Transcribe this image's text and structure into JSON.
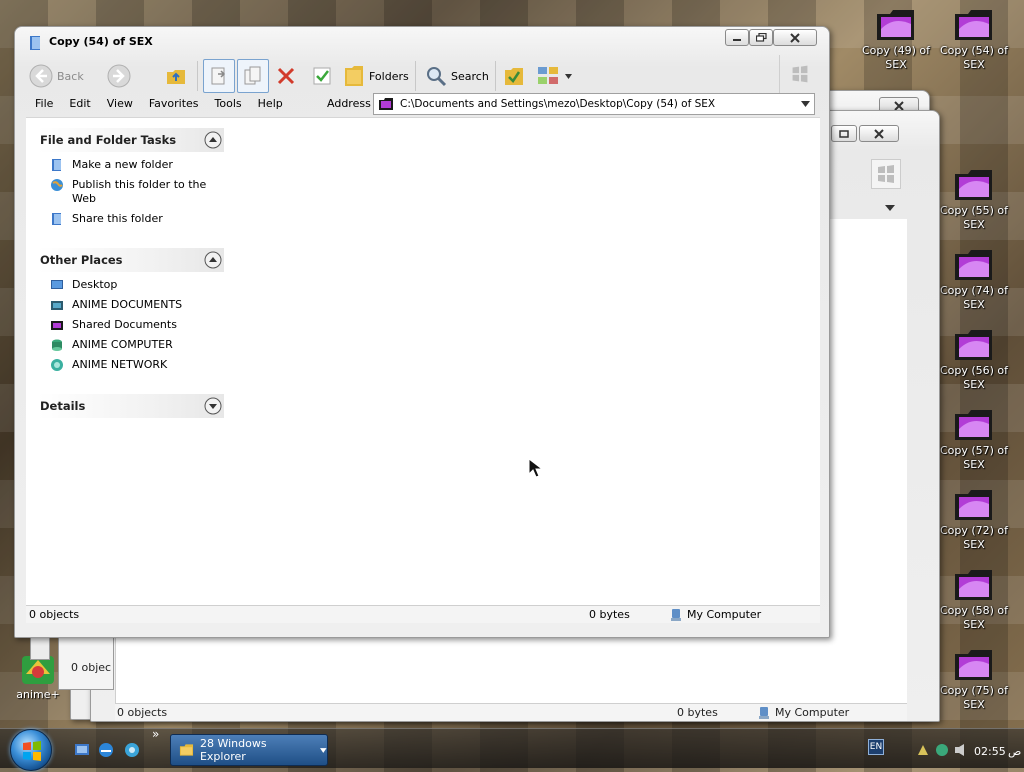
{
  "desktop": {
    "icons": [
      {
        "label": "Copy (49) of SEX"
      },
      {
        "label": "Copy (54) of SEX"
      },
      {
        "label": "Copy (55) of SEX"
      },
      {
        "label": "Copy (74) of SEX"
      },
      {
        "label": "Copy (56) of SEX"
      },
      {
        "label": "Copy (57) of SEX"
      },
      {
        "label": "Copy (72) of SEX"
      },
      {
        "label": "Copy (58) of SEX"
      },
      {
        "label": "Copy (75) of SEX"
      },
      {
        "label": "anime+"
      }
    ]
  },
  "main_window": {
    "title": "Copy (54) of SEX",
    "toolbar": {
      "back_label": "Back",
      "folders_label": "Folders",
      "search_label": "Search"
    },
    "menu": [
      "File",
      "Edit",
      "View",
      "Favorites",
      "Tools",
      "Help"
    ],
    "address": {
      "label": "Address",
      "value": "C:\\Documents and Settings\\mezo\\Desktop\\Copy (54) of SEX"
    },
    "task_pane": {
      "file_folder_tasks": {
        "title": "File and Folder Tasks",
        "items": [
          "Make a new folder",
          "Publish this folder to the Web",
          "Share this folder"
        ]
      },
      "other_places": {
        "title": "Other Places",
        "items": [
          "Desktop",
          "ANIME DOCUMENTS",
          "Shared Documents",
          "ANIME COMPUTER",
          "ANIME NETWORK"
        ]
      },
      "details": {
        "title": "Details"
      }
    },
    "status": {
      "objects": "0 objects",
      "size": "0 bytes",
      "zone": "My Computer"
    }
  },
  "background_windows": {
    "status_objects": "0 objects",
    "status_objects_short": "0 objec",
    "status_size": "0 bytes",
    "status_zone": "My Computer"
  },
  "taskbar": {
    "task_button": "28 Windows Explorer",
    "language": "EN",
    "time": "02:55",
    "time_suffix": "ص",
    "quick_launch_more": "»"
  },
  "colors": {
    "folder_purple": "#b23cd6",
    "taskbar_button": "#2e5f99",
    "close_red": "#c0392b"
  }
}
